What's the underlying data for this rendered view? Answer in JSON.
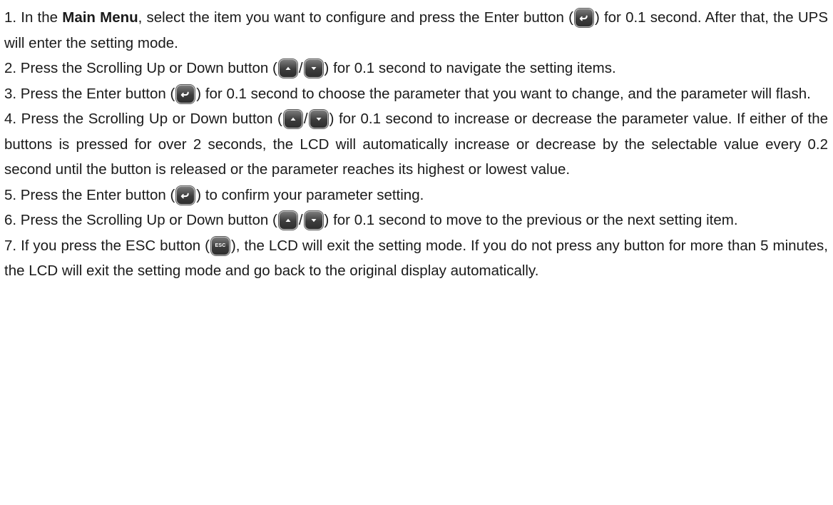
{
  "steps": [
    {
      "n1": "1. In the ",
      "bold": "Main Menu",
      "t1": ", select the item you want to configure and press the Enter button (",
      "t2": ") for 0.1 second. After that, the UPS will enter the setting mode."
    },
    {
      "t1": "2. Press the Scrolling Up or Down button (",
      "sep": "/",
      "t2": ") for 0.1 second to navigate the setting items."
    },
    {
      "t1": "3. Press the Enter button (",
      "t2": ") for 0.1 second to choose the parameter that you want to change, and the parameter will flash."
    },
    {
      "t1": "4. Press the Scrolling Up or Down button (",
      "sep": "/",
      "t2": ") for 0.1 second to increase or decrease the parameter value. If either of the buttons is pressed for over 2 seconds, the LCD will automatically increase or decrease by the selectable value every 0.2 second until the button is released or the parameter reaches its highest or lowest value."
    },
    {
      "t1": "5. Press the Enter button (",
      "t2": ") to confirm your parameter setting."
    },
    {
      "t1": "6. Press the Scrolling Up or Down button (",
      "sep": "/",
      "t2": ") for 0.1 second to move to the previous or the next setting item."
    },
    {
      "t1": "7. If you press the ESC button (",
      "t2": "), the LCD will exit the setting mode. If you do not press any button for more than 5 minutes, the LCD will exit the setting mode and go back to the original display automatically."
    }
  ],
  "icons": {
    "enter": "enter-button-icon",
    "up": "scroll-up-button-icon",
    "down": "scroll-down-button-icon",
    "esc": "esc-button-icon",
    "esc_label": "ESC"
  }
}
